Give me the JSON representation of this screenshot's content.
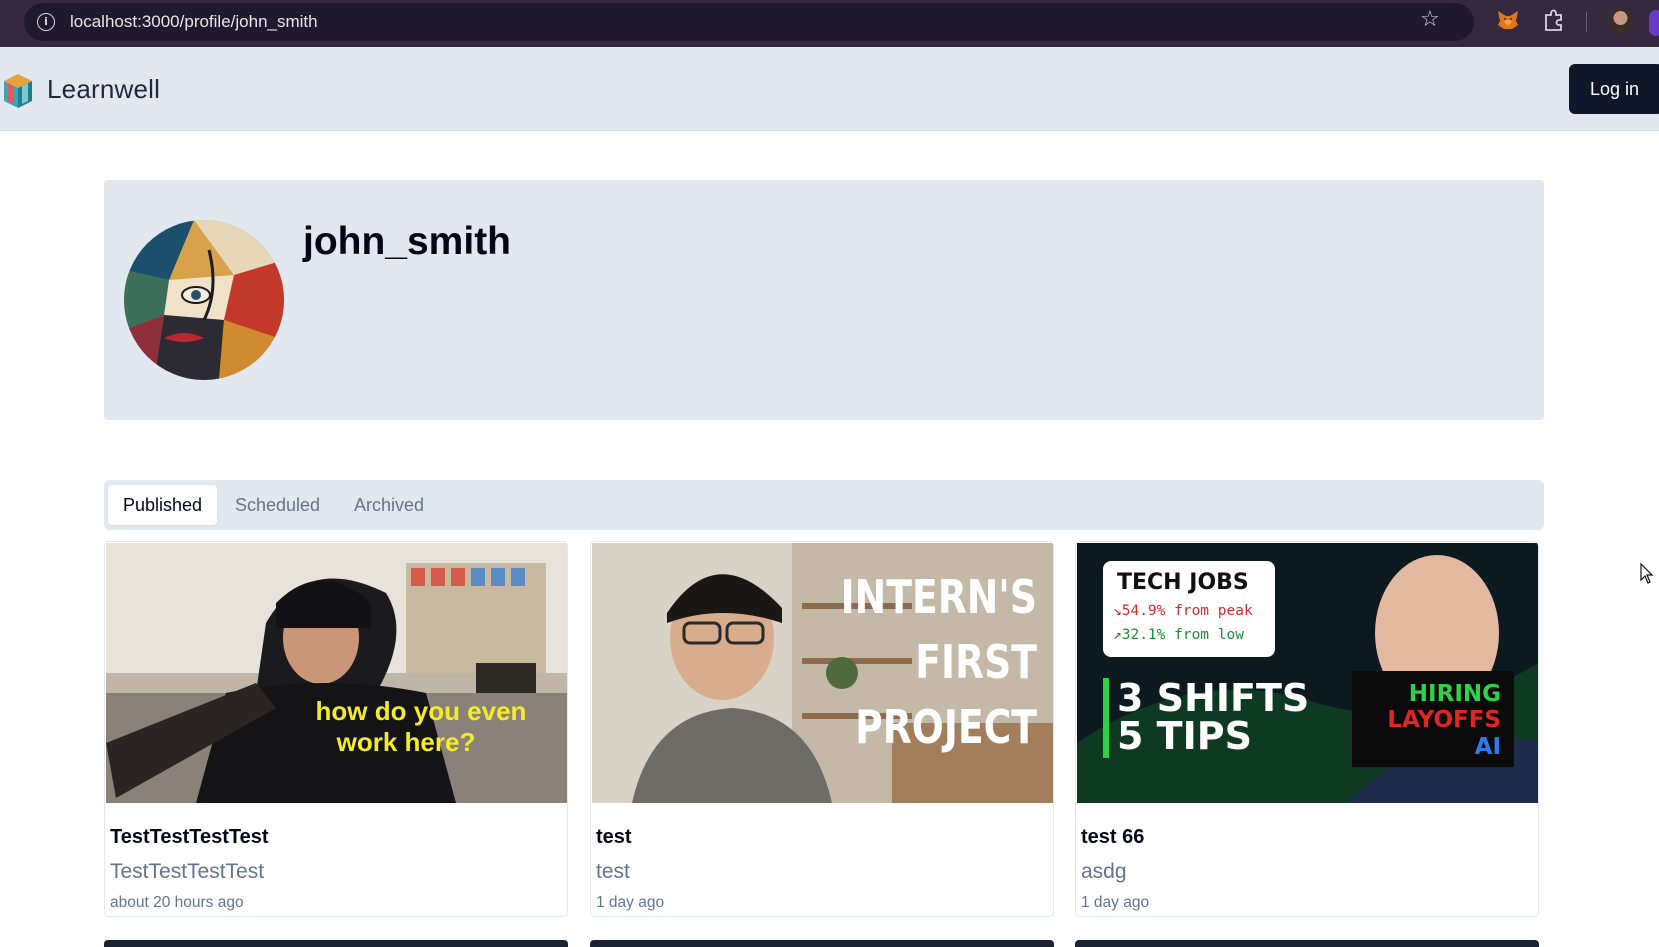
{
  "browser": {
    "url": "localhost:3000/profile/john_smith",
    "icons": [
      "info-icon",
      "star-icon",
      "metamask-fox-icon",
      "extensions-icon",
      "profile-avatar-icon"
    ]
  },
  "header": {
    "logo_text": "Learnwell",
    "login_label": "Log in"
  },
  "profile": {
    "username": "john_smith"
  },
  "tabs": [
    {
      "label": "Published",
      "active": true
    },
    {
      "label": "Scheduled",
      "active": false
    },
    {
      "label": "Archived",
      "active": false
    }
  ],
  "posts": [
    {
      "title": "TestTestTestTest",
      "subtitle": "TestTestTestTest",
      "time": "about 20 hours ago",
      "thumb_caption_line1": "how do you even",
      "thumb_caption_line2": "work here?"
    },
    {
      "title": "test",
      "subtitle": "test",
      "time": "1 day ago",
      "thumb_text_line1": "INTERN'S",
      "thumb_text_line2": "FIRST",
      "thumb_text_line3": "PROJECT"
    },
    {
      "title": "test 66",
      "subtitle": "asdg",
      "time": "1 day ago",
      "thumb_box_title": "TECH JOBS",
      "thumb_box_line1": "↘54.9% from peak",
      "thumb_box_line2": "↗32.1% from low",
      "thumb_big_line1": "3 SHIFTS",
      "thumb_big_line2": "5 TIPS",
      "thumb_badge_line1": "HIRING",
      "thumb_badge_line2": "LAYOFFS",
      "thumb_badge_line3": "AI"
    }
  ],
  "colors": {
    "header_bg": "#e2e8f0",
    "primary_button": "#0f172a",
    "browser_bar": "#35293f",
    "muted_text": "#64748b"
  }
}
